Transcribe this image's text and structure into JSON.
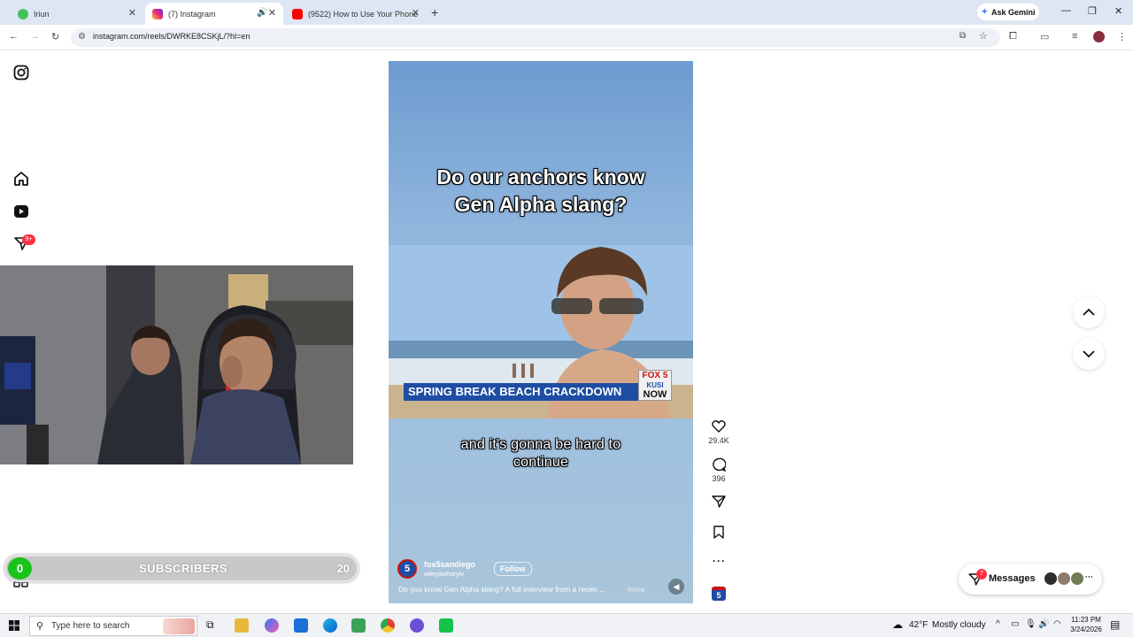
{
  "browser": {
    "tabs": [
      {
        "title": "Iriun",
        "close": "✕",
        "favicon_color": "#3ec35a"
      },
      {
        "title": "(7) Instagram",
        "close": "✕",
        "favicon_color": "#d6249f"
      },
      {
        "title": "(9522) How to Use Your Phone",
        "close": "✕",
        "favicon_color": "#ff0000"
      }
    ],
    "new_tab": "+",
    "gemini": "Ask Gemini",
    "url": "instagram.com/reels/DWRKE8CSKjL/?hl=en"
  },
  "sidebar": {
    "notification_badge": "9+"
  },
  "reel": {
    "title_line1": "Do our anchors know",
    "title_line2": "Gen Alpha slang?",
    "news_ribbon": "SPRING BREAK BEACH CRACKDOWN",
    "news_logo": "FOX 5",
    "news_logo_sub": "KUSI",
    "news_logo_now": "NOW",
    "caption_line1": "and it's gonna be hard to",
    "caption_line2": "continue",
    "account": "fox5sandiego",
    "audio": "wileyjawharytv",
    "follow": "Follow",
    "description": "Do you know Gen Alpha slang? A full interview from a recen ...",
    "more": "more",
    "avatar_label": "5"
  },
  "actions": {
    "likes": "29.4K",
    "comments": "396"
  },
  "overlay": {
    "subs_left": "0",
    "subs_label": "SUBSCRIBERS",
    "subs_right": "20"
  },
  "messages": {
    "label": "Messages",
    "badge": "7"
  },
  "taskbar": {
    "search_placeholder": "Type here to search",
    "weather_temp": "42°F",
    "weather_text": "Mostly cloudy",
    "time": "11:23 PM",
    "date": "3/24/2026"
  },
  "colors": {
    "instagram_follow": "#ffffff",
    "news_blue": "#1e4da3",
    "subs_green": "#18c418"
  }
}
